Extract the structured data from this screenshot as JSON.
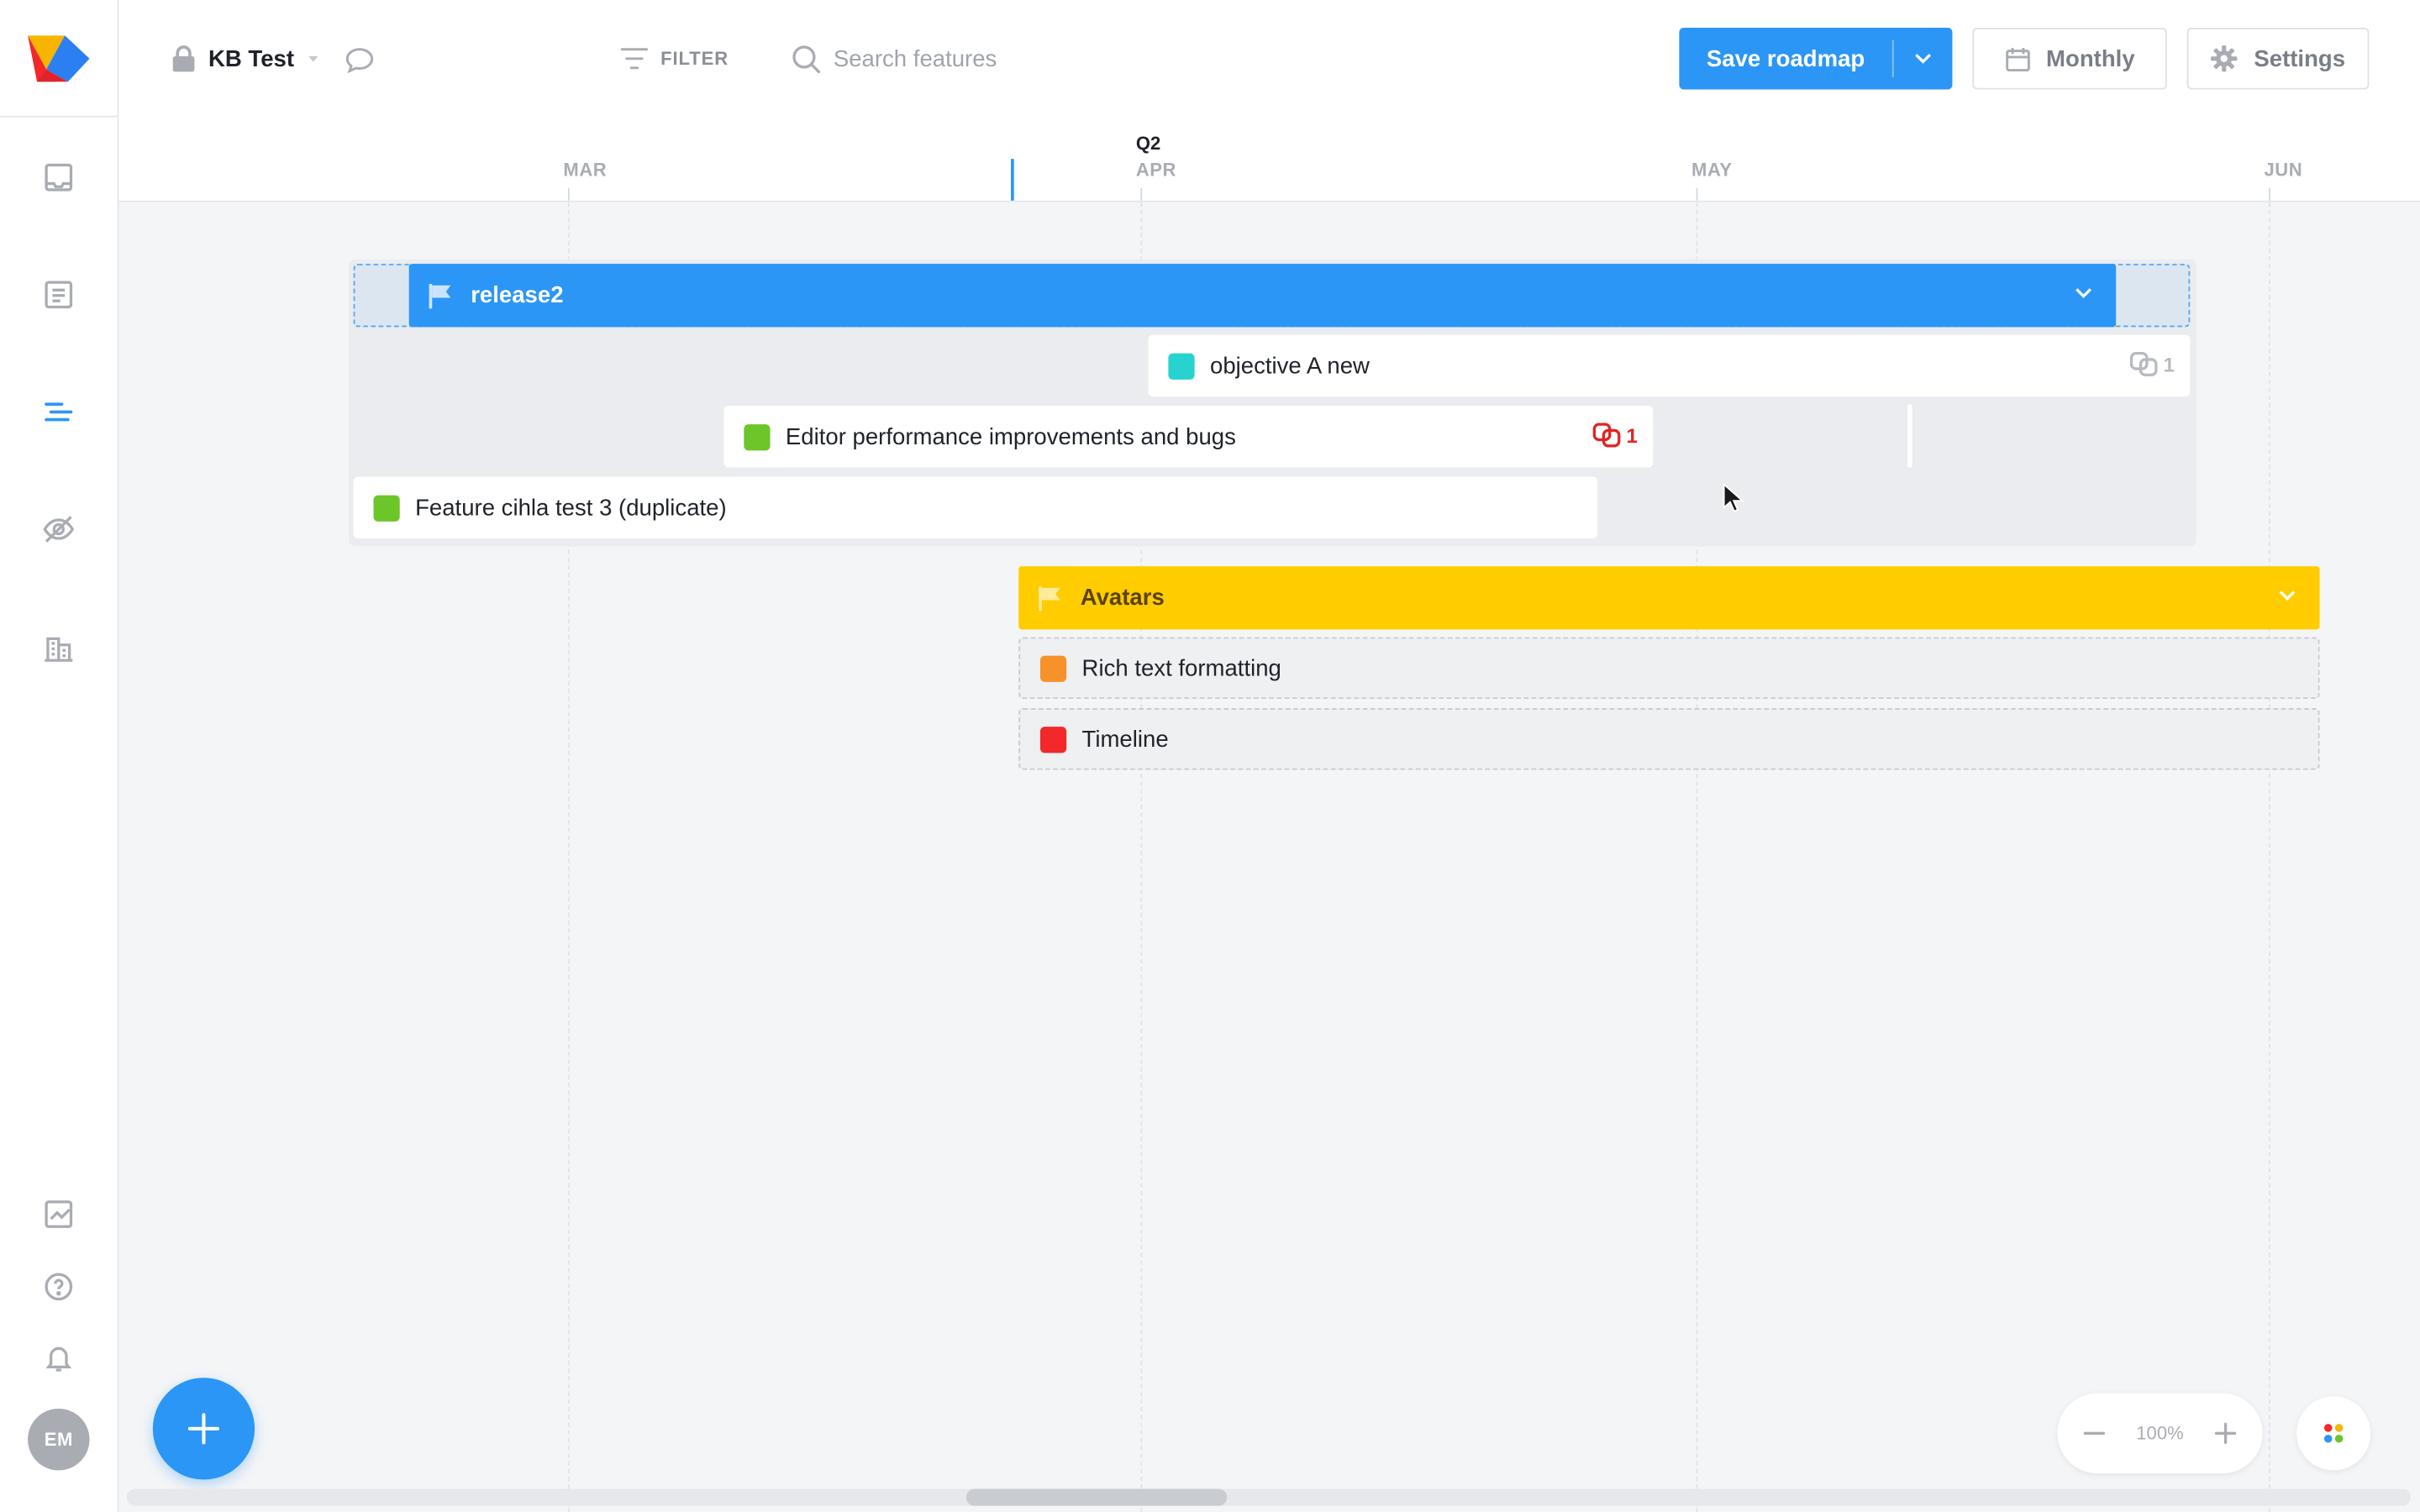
{
  "app": {
    "project_name": "KB Test",
    "accent_color": "#2b96f5"
  },
  "sidebar": {
    "items": [
      {
        "name": "inbox-icon"
      },
      {
        "name": "list-icon"
      },
      {
        "name": "roadmap-icon",
        "active": true
      },
      {
        "name": "hidden-icon"
      },
      {
        "name": "buildings-icon"
      }
    ],
    "bottom_items": [
      {
        "name": "analytics-icon"
      },
      {
        "name": "help-icon"
      },
      {
        "name": "bell-icon"
      }
    ],
    "avatar_initials": "EM"
  },
  "toolbar": {
    "filter_label": "FILTER",
    "search_placeholder": "Search features",
    "save_label": "Save roadmap",
    "view_label": "Monthly",
    "settings_label": "Settings"
  },
  "timeline": {
    "quarter_label": "Q2",
    "months": [
      "MAR",
      "APR",
      "MAY",
      "JUN"
    ]
  },
  "releases": [
    {
      "name": "release2",
      "color": "#2b96f5",
      "features": [
        {
          "name": "objective A new",
          "color": "#26d3cf",
          "dependencies": "1",
          "dep_color": "#b7bbc1"
        },
        {
          "name": "Editor performance improvements and bugs",
          "color": "#6cc62a",
          "dependencies": "1",
          "dep_color": "#e02424"
        },
        {
          "name": "Feature cihla test 3 (duplicate)",
          "color": "#6cc62a"
        }
      ]
    },
    {
      "name": "Avatars",
      "color": "#ffcc00",
      "features": [
        {
          "name": "Rich text formatting",
          "color": "#f7912a"
        },
        {
          "name": "Timeline",
          "color": "#f2282a"
        }
      ]
    }
  ],
  "zoom": {
    "level": "100%"
  }
}
